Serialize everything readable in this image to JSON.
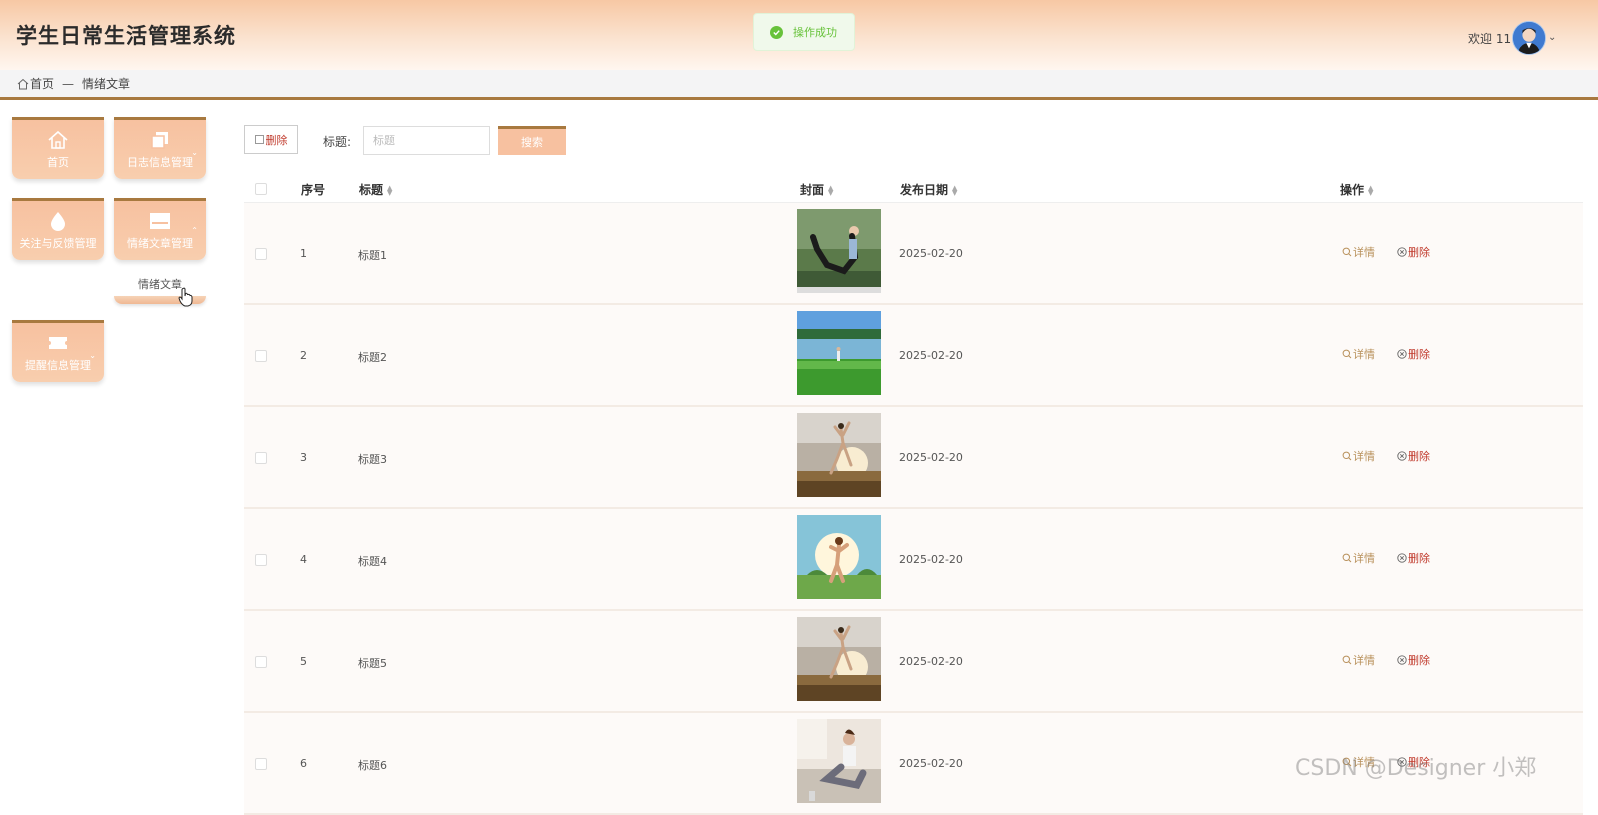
{
  "header": {
    "app_title": "学生日常生活管理系统",
    "toast_text": "操作成功",
    "welcome_text": "欢迎 11"
  },
  "breadcrumb": {
    "home": "首页",
    "separator": "—",
    "current": "情绪文章"
  },
  "sidebar": {
    "items": [
      {
        "label": "首页",
        "icon": "home-icon"
      },
      {
        "label": "日志信息管理",
        "icon": "copy-icon"
      },
      {
        "label": "关注与反馈管理",
        "icon": "drop-icon"
      },
      {
        "label": "情绪文章管理",
        "icon": "article-icon"
      },
      {
        "label": "提醒信息管理",
        "icon": "ticket-icon"
      }
    ],
    "submenu": {
      "label": "情绪文章"
    }
  },
  "toolbar": {
    "delete_label": "删除",
    "search_label": "标题:",
    "search_placeholder": "标题",
    "search_button": "搜索"
  },
  "table": {
    "headers": {
      "index": "序号",
      "title": "标题",
      "cover": "封面",
      "date": "发布日期",
      "actions": "操作"
    },
    "rows": [
      {
        "index": "1",
        "title": "标题1",
        "date": "2025-02-20",
        "cover": "yoga-bow-pose"
      },
      {
        "index": "2",
        "title": "标题2",
        "date": "2025-02-20",
        "cover": "lake-meadow"
      },
      {
        "index": "3",
        "title": "标题3",
        "date": "2025-02-20",
        "cover": "sunset-dance"
      },
      {
        "index": "4",
        "title": "标题4",
        "date": "2025-02-20",
        "cover": "sunlight-yoga"
      },
      {
        "index": "5",
        "title": "标题5",
        "date": "2025-02-20",
        "cover": "sunset-dance"
      },
      {
        "index": "6",
        "title": "标题6",
        "date": "2025-02-20",
        "cover": "indoor-sitting"
      }
    ],
    "action_detail": "详情",
    "action_delete": "删除"
  },
  "watermark": "CSDN @Designer 小郑",
  "colors": {
    "accent": "#a8793f",
    "tile": "#f7c1a0",
    "detail": "#b8905a",
    "danger": "#c0392b",
    "success": "#67c23a"
  }
}
